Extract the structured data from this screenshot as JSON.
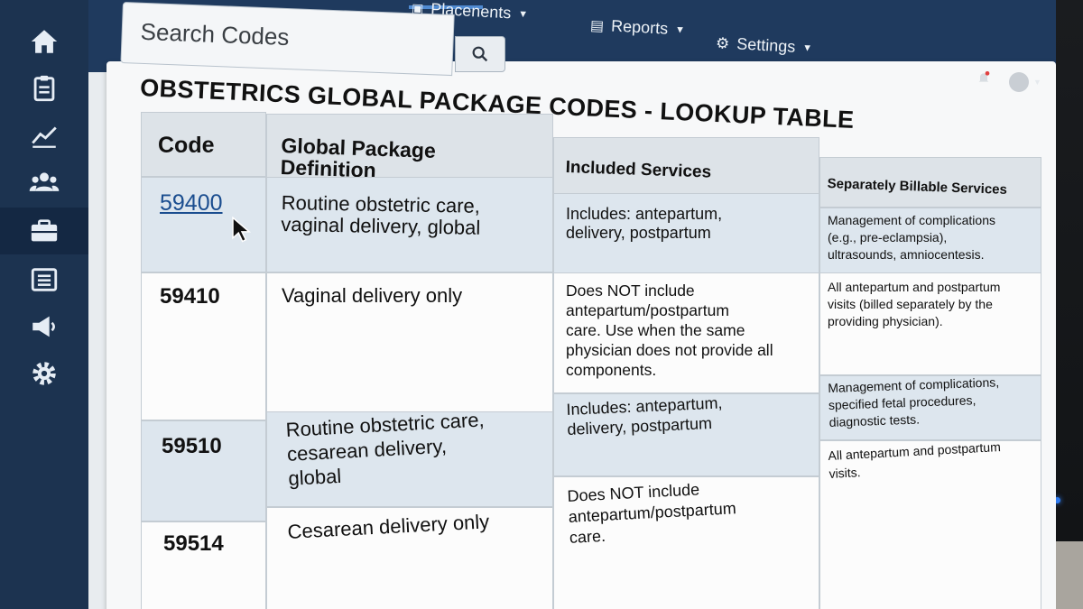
{
  "nav": {
    "search_placeholder": "Search Codes",
    "items": [
      {
        "label": "Placenents",
        "icon": "placements-icon"
      },
      {
        "label": "Reports",
        "icon": "reports-icon"
      },
      {
        "label": "Settings",
        "icon": "gear-icon"
      }
    ]
  },
  "sidebar": {
    "items": [
      {
        "icon": "home-icon"
      },
      {
        "icon": "clipboard-icon"
      },
      {
        "icon": "chart-icon"
      },
      {
        "icon": "users-icon"
      },
      {
        "icon": "briefcase-icon",
        "active": true
      },
      {
        "icon": "list-icon"
      },
      {
        "icon": "megaphone-icon"
      },
      {
        "icon": "gear-icon"
      }
    ]
  },
  "page": {
    "title": "OBSTETRICS GLOBAL PACKAGE CODES - LOOKUP TABLE"
  },
  "table": {
    "headers": [
      "Code",
      "Global Package\nDefinition",
      "Included Services",
      "Separately Billable Services"
    ],
    "rows": [
      {
        "code": "59400",
        "definition": "Routine obstetric care,\nvaginal delivery, global",
        "included": "Includes: antepartum,\ndelivery, postpartum",
        "billable": "Management of complications\n(e.g., pre-eclampsia),\nultrasounds, amniocentesis."
      },
      {
        "code": "59410",
        "definition": "Vaginal delivery only",
        "included": "Does NOT include\nantepartum/postpartum\ncare. Use when the same\nphysician does not provide all\ncomponents.",
        "billable": "All antepartum and postpartum\nvisits (billed separately by the\nproviding physician)."
      },
      {
        "code": "59510",
        "definition": "Routine obstetric care,\ncesarean delivery,\nglobal",
        "included": "Includes: antepartum,\ndelivery, postpartum",
        "billable": "Management of complications,\nspecified fetal procedures,\ndiagnostic tests."
      },
      {
        "code": "59514",
        "definition": "Cesarean delivery only",
        "included": "Does NOT include\nantepartum/postpartum\ncare.",
        "billable": "All antepartum and postpartum\nvisits."
      }
    ]
  },
  "colors": {
    "sidebar": "#1c3350",
    "topbar": "#1f3a5e",
    "link": "#1a4d8f",
    "row_shade": "#dde6ee"
  }
}
